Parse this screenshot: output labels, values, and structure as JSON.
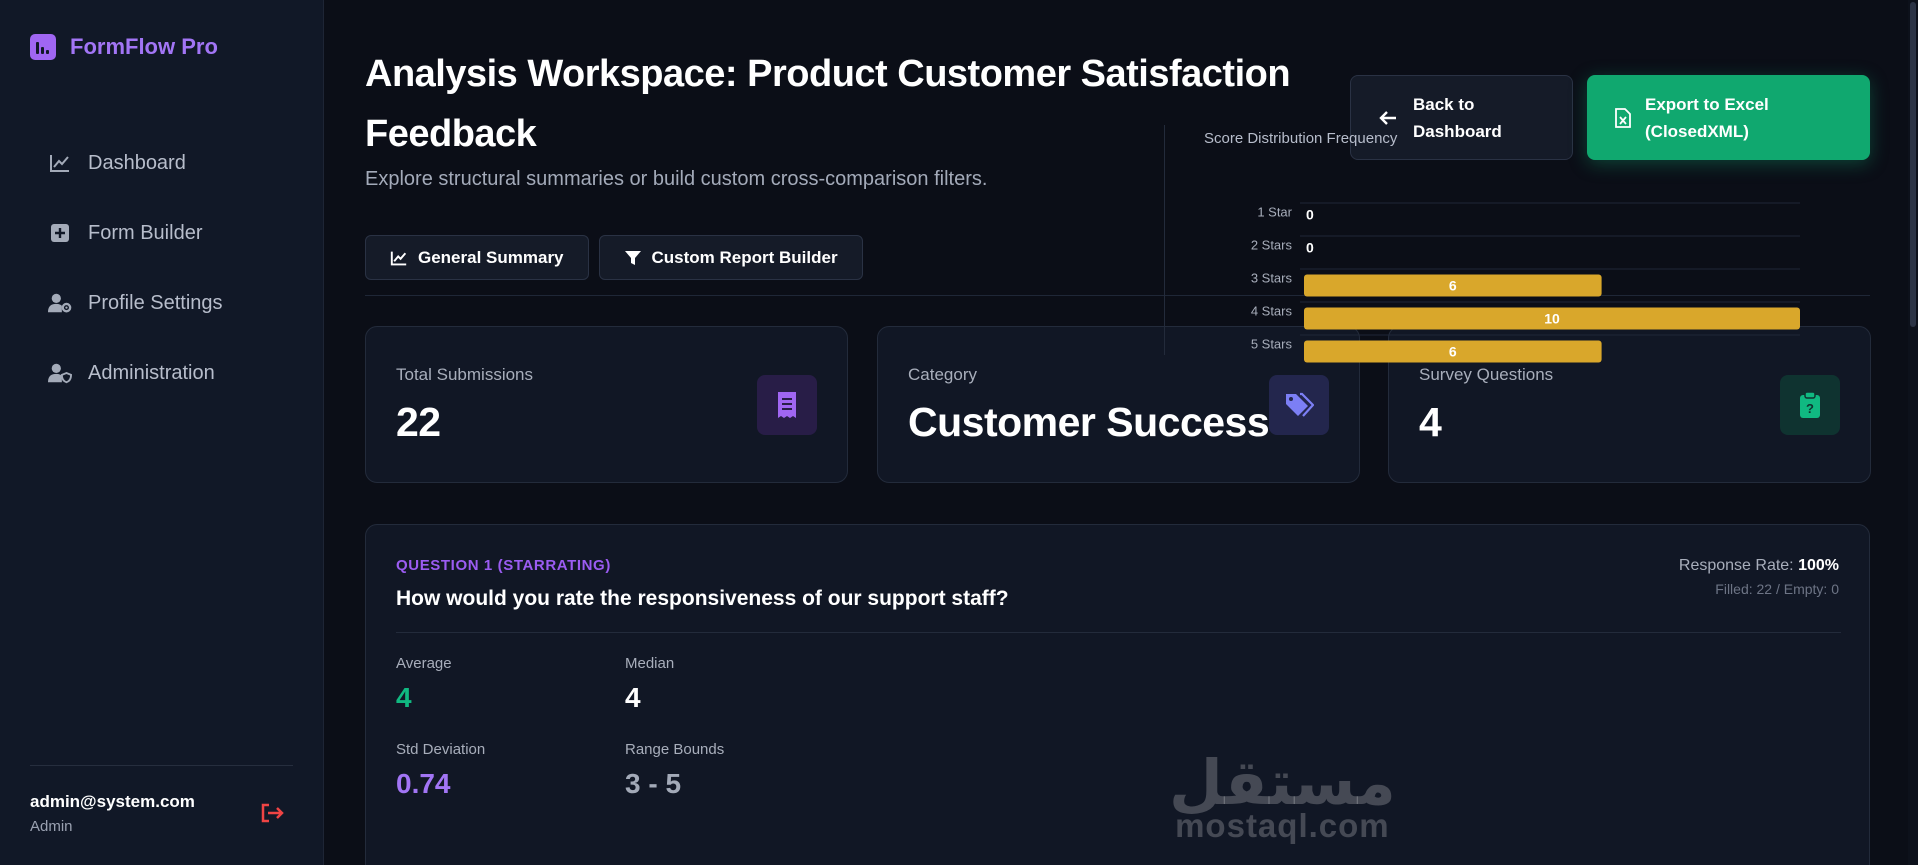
{
  "app": {
    "brand": "FormFlow Pro"
  },
  "sidebar": {
    "items": [
      {
        "label": "Dashboard",
        "icon": "chart-line-icon"
      },
      {
        "label": "Form Builder",
        "icon": "plus-square-icon"
      },
      {
        "label": "Profile Settings",
        "icon": "user-gear-icon"
      },
      {
        "label": "Administration",
        "icon": "user-shield-icon"
      }
    ],
    "user": {
      "email": "admin@system.com",
      "role": "Admin"
    }
  },
  "header": {
    "title": "Analysis Workspace: Product Customer Satisfaction Feedback",
    "subtitle": "Explore structural summaries or build custom cross-comparison filters.",
    "back_label": "Back to Dashboard",
    "export_label": "Export to Excel (ClosedXML)"
  },
  "tabs": [
    {
      "label": "General Summary",
      "icon": "chart-line-icon"
    },
    {
      "label": "Custom Report Builder",
      "icon": "filter-icon"
    }
  ],
  "stats": [
    {
      "label": "Total Submissions",
      "value": "22",
      "icon": "receipt-icon",
      "color": "#a066f2"
    },
    {
      "label": "Category",
      "value": "Customer Success",
      "icon": "tags-icon",
      "color": "#7c7ff5"
    },
    {
      "label": "Survey Questions",
      "value": "4",
      "icon": "clipboard-question-icon",
      "color": "#10b981"
    }
  ],
  "question": {
    "tag": "QUESTION 1 (STARRATING)",
    "title": "How would you rate the responsiveness of our support staff?",
    "response_rate_label": "Response Rate:",
    "response_rate_value": "100%",
    "filled_empty": "Filled: 22 / Empty: 0",
    "metrics": {
      "average_label": "Average",
      "average_value": "4",
      "median_label": "Median",
      "median_value": "4",
      "std_label": "Std Deviation",
      "std_value": "0.74",
      "range_label": "Range Bounds",
      "range_value": "3 - 5"
    },
    "chart_title": "Score Distribution Frequency"
  },
  "chart_data": {
    "type": "bar",
    "orientation": "horizontal",
    "categories": [
      "1 Star",
      "2 Stars",
      "3 Stars",
      "4 Stars",
      "5 Stars"
    ],
    "values": [
      0,
      0,
      6,
      10,
      6
    ],
    "xlim": [
      0,
      10
    ],
    "bar_color": "#d9a72b",
    "grid": true
  },
  "colors": {
    "accent": "#a066f2",
    "success": "#10a86f",
    "average": "#10b981",
    "std": "#a275f5",
    "range": "#a3aab8",
    "logout": "#ef4444"
  },
  "watermark": {
    "line1": "مستقل",
    "line2": "mostaql.com"
  }
}
